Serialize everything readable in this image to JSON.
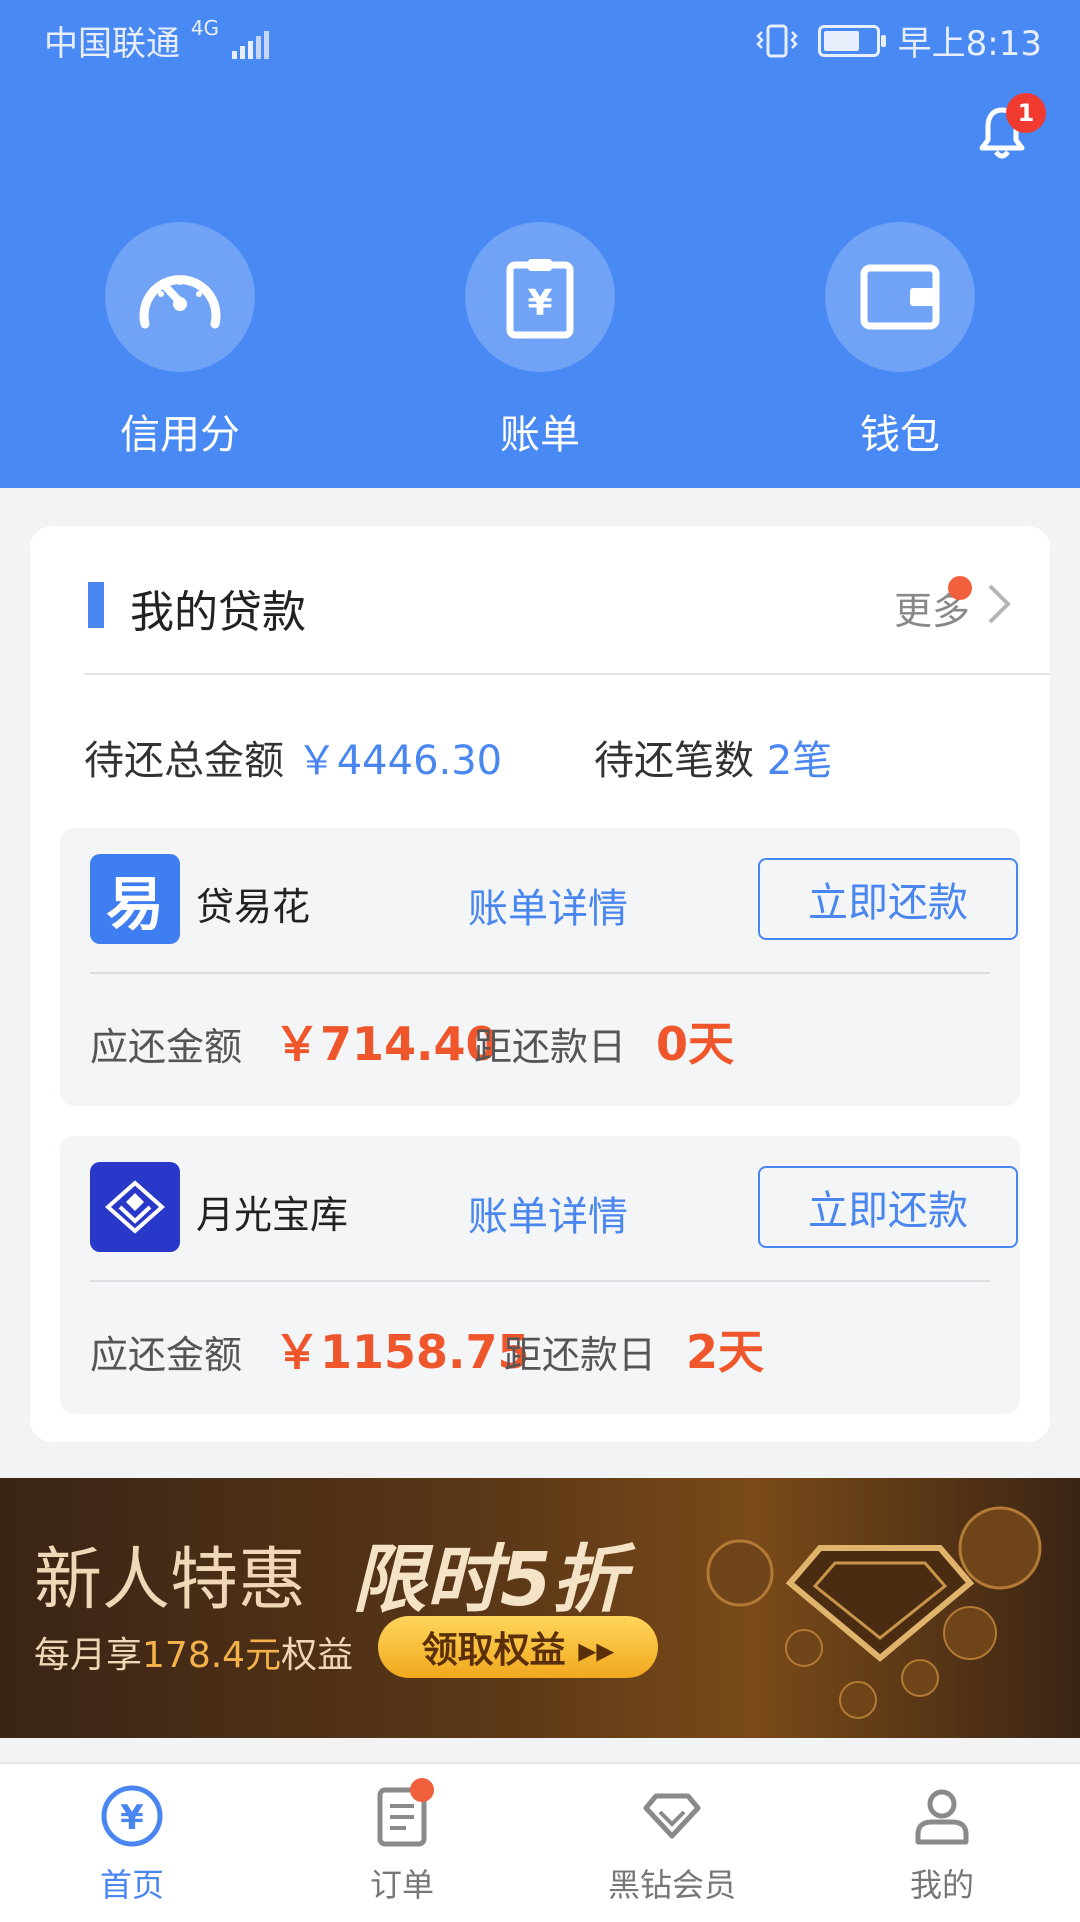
{
  "status_bar": {
    "carrier": "中国联通",
    "network": "4G",
    "time": "早上8:13",
    "battery_level": 0.7
  },
  "header": {
    "notification_count": "1"
  },
  "quick_actions": [
    {
      "label": "信用分",
      "icon": "speedometer-icon"
    },
    {
      "label": "账单",
      "icon": "bill-icon"
    },
    {
      "label": "钱包",
      "icon": "wallet-icon"
    }
  ],
  "loans_section": {
    "title": "我的贷款",
    "more_label": "更多",
    "total_label": "待还总金额",
    "total_value": "￥4446.30",
    "count_label": "待还笔数",
    "count_value": "2笔",
    "items": [
      {
        "name": "贷易花",
        "logo_text": "易",
        "logo_color": "#3f7ef0",
        "detail_label": "账单详情",
        "pay_label": "立即还款",
        "amount_label": "应还金额",
        "amount_value": "￥714.40",
        "due_label": "距还款日",
        "due_value": "0天"
      },
      {
        "name": "月光宝库",
        "logo_text": "",
        "logo_color": "#2838c8",
        "detail_label": "账单详情",
        "pay_label": "立即还款",
        "amount_label": "应还金额",
        "amount_value": "￥1158.75",
        "due_label": "距还款日",
        "due_value": "2天"
      }
    ]
  },
  "banner": {
    "title_1": "新人特惠",
    "title_2": "限时5折",
    "sub_prefix": "每月享",
    "sub_highlight": "178.4元",
    "sub_suffix": "权益",
    "cta": "领取权益 ▸▸"
  },
  "tabbar": [
    {
      "label": "首页",
      "icon": "yuan-circle-icon",
      "active": true
    },
    {
      "label": "订单",
      "icon": "order-list-icon",
      "active": false
    },
    {
      "label": "黑钻会员",
      "icon": "diamond-icon",
      "active": false
    },
    {
      "label": "我的",
      "icon": "user-icon",
      "active": false
    }
  ],
  "colors": {
    "primary": "#4889f4",
    "accent_orange": "#f0562c",
    "link_blue": "#4a86f0"
  }
}
